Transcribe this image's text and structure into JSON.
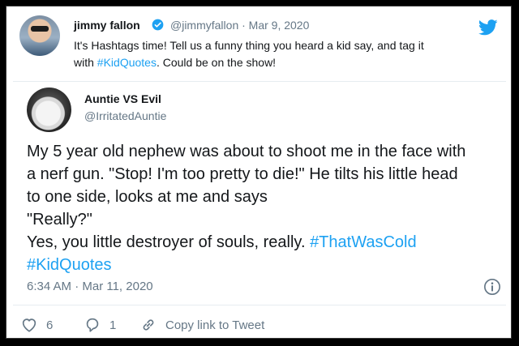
{
  "quoted_tweet": {
    "display_name": "jimmy fallon",
    "handle_and_date": "@jimmyfallon · Mar 9, 2020",
    "text_parts": [
      "It's Hashtags time! Tell us a funny thing you heard a kid say, and tag it",
      "with ",
      "#KidQuotes",
      ". Could be on the show!"
    ]
  },
  "reply_tweet": {
    "display_name": "Auntie VS Evil",
    "handle": "@IrritatedAuntie",
    "lines": [
      "My 5 year old nephew was about to shoot me in the face with",
      "a nerf gun. \"Stop! I'm too pretty to die!\" He tilts his little head",
      "to one side, looks at me and says",
      "\"Really?\"",
      "Yes, you little destroyer of souls, really. "
    ],
    "hashtag_1": "#ThatWasCold",
    "hashtag_2": "#KidQuotes",
    "timestamp": "6:34 AM · Mar 11, 2020"
  },
  "actions": {
    "like_count": "6",
    "reply_count": "1",
    "copy_link_label": "Copy link to Tweet"
  },
  "icons": [
    "verified-icon",
    "twitter-bird-icon",
    "info-icon",
    "heart-icon",
    "reply-icon",
    "link-icon"
  ],
  "colors": {
    "accent": "#1da1f2",
    "text": "#14171a",
    "secondary": "#657786"
  }
}
